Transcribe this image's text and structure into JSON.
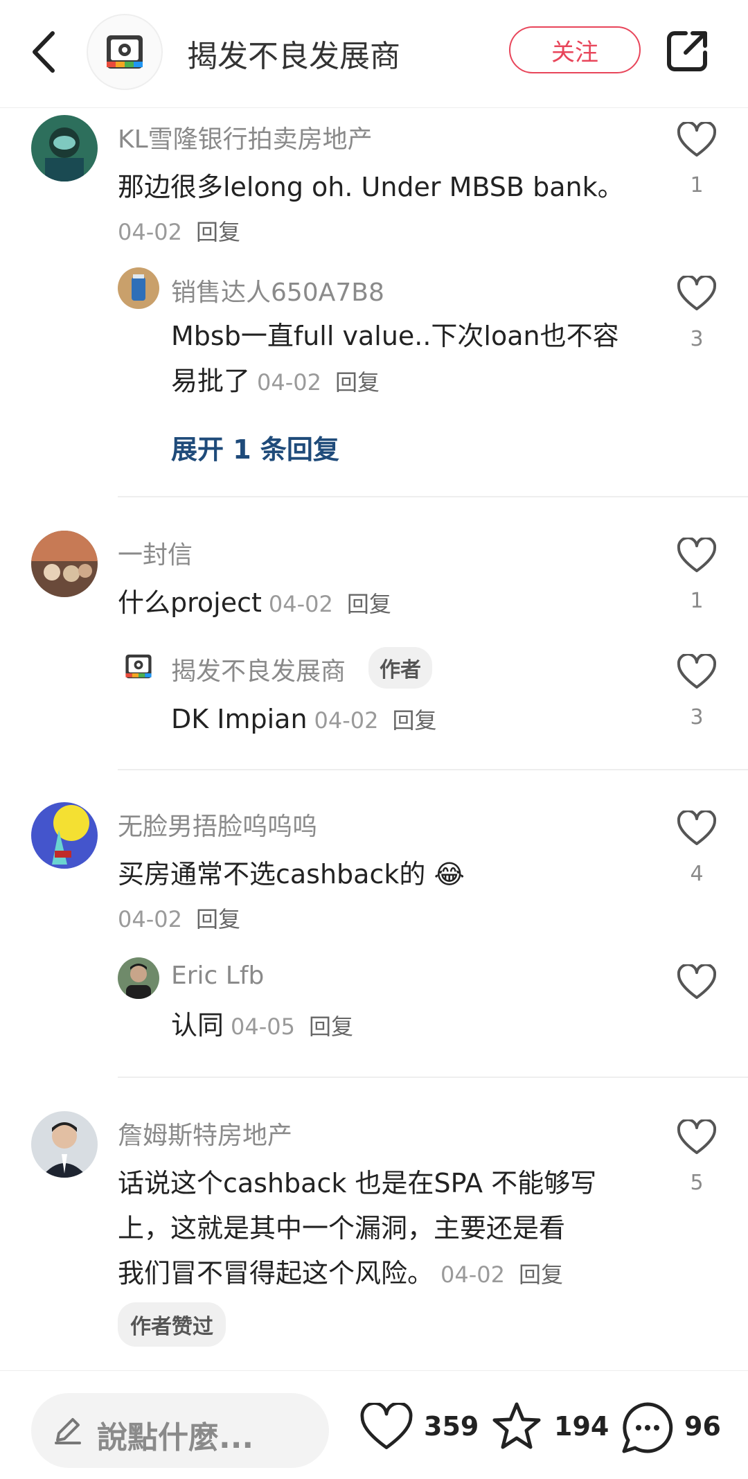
{
  "header": {
    "title": "揭发不良发展商",
    "follow_label": "关注"
  },
  "comments": [
    {
      "name": "KL雪隆银行拍卖房地产",
      "text": "那边很多lelong oh. Under MBSB bank。",
      "date": "04-02",
      "reply": "回复",
      "likes": "1",
      "replies": [
        {
          "name": "销售达人650A7B8",
          "text_line1": "Mbsb一直full value..下次loan也不容",
          "text_line2": "易批了",
          "date": "04-02",
          "reply": "回复",
          "likes": "3"
        }
      ],
      "expand_label": "展开 1 条回复"
    },
    {
      "name": "一封信",
      "text": "什么project",
      "date": "04-02",
      "reply": "回复",
      "likes": "1",
      "replies": [
        {
          "name": "揭发不良发展商",
          "badge": "作者",
          "text": "DK Impian",
          "date": "04-02",
          "reply": "回复",
          "likes": "3"
        }
      ]
    },
    {
      "name": "无脸男捂脸呜呜呜",
      "text": "买房通常不选cashback的 😂",
      "date": "04-02",
      "reply": "回复",
      "likes": "4",
      "replies": [
        {
          "name": "Eric Lfb",
          "text": "认同",
          "date": "04-05",
          "reply": "回复"
        }
      ]
    },
    {
      "name": "詹姆斯特房地产",
      "text_line1": "话说这个cashback 也是在SPA 不能够写",
      "text_line2": "上，这就是其中一个漏洞，主要还是看",
      "text_line3": "我们冒不冒得起这个风险。",
      "date": "04-02",
      "reply": "回复",
      "likes": "5",
      "badge": "作者赞过"
    }
  ],
  "bottom_bar": {
    "placeholder": "說點什麼...",
    "likes": "359",
    "stars": "194",
    "comments": "96"
  },
  "colors": {
    "accent": "#e8455a",
    "link": "#1f4b7a"
  }
}
